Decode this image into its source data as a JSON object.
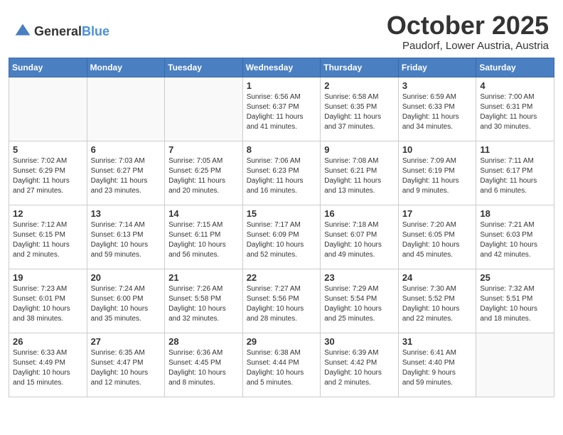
{
  "header": {
    "logo_general": "General",
    "logo_blue": "Blue",
    "month": "October 2025",
    "location": "Paudorf, Lower Austria, Austria"
  },
  "weekdays": [
    "Sunday",
    "Monday",
    "Tuesday",
    "Wednesday",
    "Thursday",
    "Friday",
    "Saturday"
  ],
  "weeks": [
    [
      {
        "day": "",
        "info": ""
      },
      {
        "day": "",
        "info": ""
      },
      {
        "day": "",
        "info": ""
      },
      {
        "day": "1",
        "info": "Sunrise: 6:56 AM\nSunset: 6:37 PM\nDaylight: 11 hours\nand 41 minutes."
      },
      {
        "day": "2",
        "info": "Sunrise: 6:58 AM\nSunset: 6:35 PM\nDaylight: 11 hours\nand 37 minutes."
      },
      {
        "day": "3",
        "info": "Sunrise: 6:59 AM\nSunset: 6:33 PM\nDaylight: 11 hours\nand 34 minutes."
      },
      {
        "day": "4",
        "info": "Sunrise: 7:00 AM\nSunset: 6:31 PM\nDaylight: 11 hours\nand 30 minutes."
      }
    ],
    [
      {
        "day": "5",
        "info": "Sunrise: 7:02 AM\nSunset: 6:29 PM\nDaylight: 11 hours\nand 27 minutes."
      },
      {
        "day": "6",
        "info": "Sunrise: 7:03 AM\nSunset: 6:27 PM\nDaylight: 11 hours\nand 23 minutes."
      },
      {
        "day": "7",
        "info": "Sunrise: 7:05 AM\nSunset: 6:25 PM\nDaylight: 11 hours\nand 20 minutes."
      },
      {
        "day": "8",
        "info": "Sunrise: 7:06 AM\nSunset: 6:23 PM\nDaylight: 11 hours\nand 16 minutes."
      },
      {
        "day": "9",
        "info": "Sunrise: 7:08 AM\nSunset: 6:21 PM\nDaylight: 11 hours\nand 13 minutes."
      },
      {
        "day": "10",
        "info": "Sunrise: 7:09 AM\nSunset: 6:19 PM\nDaylight: 11 hours\nand 9 minutes."
      },
      {
        "day": "11",
        "info": "Sunrise: 7:11 AM\nSunset: 6:17 PM\nDaylight: 11 hours\nand 6 minutes."
      }
    ],
    [
      {
        "day": "12",
        "info": "Sunrise: 7:12 AM\nSunset: 6:15 PM\nDaylight: 11 hours\nand 2 minutes."
      },
      {
        "day": "13",
        "info": "Sunrise: 7:14 AM\nSunset: 6:13 PM\nDaylight: 10 hours\nand 59 minutes."
      },
      {
        "day": "14",
        "info": "Sunrise: 7:15 AM\nSunset: 6:11 PM\nDaylight: 10 hours\nand 56 minutes."
      },
      {
        "day": "15",
        "info": "Sunrise: 7:17 AM\nSunset: 6:09 PM\nDaylight: 10 hours\nand 52 minutes."
      },
      {
        "day": "16",
        "info": "Sunrise: 7:18 AM\nSunset: 6:07 PM\nDaylight: 10 hours\nand 49 minutes."
      },
      {
        "day": "17",
        "info": "Sunrise: 7:20 AM\nSunset: 6:05 PM\nDaylight: 10 hours\nand 45 minutes."
      },
      {
        "day": "18",
        "info": "Sunrise: 7:21 AM\nSunset: 6:03 PM\nDaylight: 10 hours\nand 42 minutes."
      }
    ],
    [
      {
        "day": "19",
        "info": "Sunrise: 7:23 AM\nSunset: 6:01 PM\nDaylight: 10 hours\nand 38 minutes."
      },
      {
        "day": "20",
        "info": "Sunrise: 7:24 AM\nSunset: 6:00 PM\nDaylight: 10 hours\nand 35 minutes."
      },
      {
        "day": "21",
        "info": "Sunrise: 7:26 AM\nSunset: 5:58 PM\nDaylight: 10 hours\nand 32 minutes."
      },
      {
        "day": "22",
        "info": "Sunrise: 7:27 AM\nSunset: 5:56 PM\nDaylight: 10 hours\nand 28 minutes."
      },
      {
        "day": "23",
        "info": "Sunrise: 7:29 AM\nSunset: 5:54 PM\nDaylight: 10 hours\nand 25 minutes."
      },
      {
        "day": "24",
        "info": "Sunrise: 7:30 AM\nSunset: 5:52 PM\nDaylight: 10 hours\nand 22 minutes."
      },
      {
        "day": "25",
        "info": "Sunrise: 7:32 AM\nSunset: 5:51 PM\nDaylight: 10 hours\nand 18 minutes."
      }
    ],
    [
      {
        "day": "26",
        "info": "Sunrise: 6:33 AM\nSunset: 4:49 PM\nDaylight: 10 hours\nand 15 minutes."
      },
      {
        "day": "27",
        "info": "Sunrise: 6:35 AM\nSunset: 4:47 PM\nDaylight: 10 hours\nand 12 minutes."
      },
      {
        "day": "28",
        "info": "Sunrise: 6:36 AM\nSunset: 4:45 PM\nDaylight: 10 hours\nand 8 minutes."
      },
      {
        "day": "29",
        "info": "Sunrise: 6:38 AM\nSunset: 4:44 PM\nDaylight: 10 hours\nand 5 minutes."
      },
      {
        "day": "30",
        "info": "Sunrise: 6:39 AM\nSunset: 4:42 PM\nDaylight: 10 hours\nand 2 minutes."
      },
      {
        "day": "31",
        "info": "Sunrise: 6:41 AM\nSunset: 4:40 PM\nDaylight: 9 hours\nand 59 minutes."
      },
      {
        "day": "",
        "info": ""
      }
    ]
  ]
}
